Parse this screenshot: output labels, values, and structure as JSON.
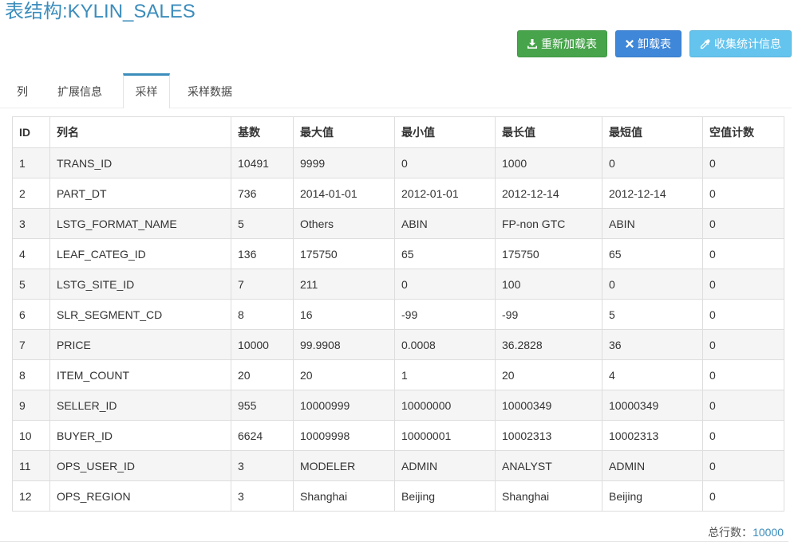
{
  "page": {
    "title": "表结构:KYLIN_SALES"
  },
  "toolbar": {
    "reload": {
      "label": "重新加载表",
      "icon": "download-icon"
    },
    "unload": {
      "label": "卸载表",
      "icon": "close-icon"
    },
    "collect_stats": {
      "label": "收集统计信息",
      "icon": "eyedropper-icon"
    }
  },
  "tabs": [
    {
      "label": "列",
      "active": false
    },
    {
      "label": "扩展信息",
      "active": false
    },
    {
      "label": "采样",
      "active": true
    },
    {
      "label": "采样数据",
      "active": false
    }
  ],
  "sample_table": {
    "headers": [
      "ID",
      "列名",
      "基数",
      "最大值",
      "最小值",
      "最长值",
      "最短值",
      "空值计数"
    ],
    "rows": [
      [
        "1",
        "TRANS_ID",
        "10491",
        "9999",
        "0",
        "1000",
        "0",
        "0"
      ],
      [
        "2",
        "PART_DT",
        "736",
        "2014-01-01",
        "2012-01-01",
        "2012-12-14",
        "2012-12-14",
        "0"
      ],
      [
        "3",
        "LSTG_FORMAT_NAME",
        "5",
        "Others",
        "ABIN",
        "FP-non GTC",
        "ABIN",
        "0"
      ],
      [
        "4",
        "LEAF_CATEG_ID",
        "136",
        "175750",
        "65",
        "175750",
        "65",
        "0"
      ],
      [
        "5",
        "LSTG_SITE_ID",
        "7",
        "211",
        "0",
        "100",
        "0",
        "0"
      ],
      [
        "6",
        "SLR_SEGMENT_CD",
        "8",
        "16",
        "-99",
        "-99",
        "5",
        "0"
      ],
      [
        "7",
        "PRICE",
        "10000",
        "99.9908",
        "0.0008",
        "36.2828",
        "36",
        "0"
      ],
      [
        "8",
        "ITEM_COUNT",
        "20",
        "20",
        "1",
        "20",
        "4",
        "0"
      ],
      [
        "9",
        "SELLER_ID",
        "955",
        "10000999",
        "10000000",
        "10000349",
        "10000349",
        "0"
      ],
      [
        "10",
        "BUYER_ID",
        "6624",
        "10009998",
        "10000001",
        "10002313",
        "10002313",
        "0"
      ],
      [
        "11",
        "OPS_USER_ID",
        "3",
        "MODELER",
        "ADMIN",
        "ANALYST",
        "ADMIN",
        "0"
      ],
      [
        "12",
        "OPS_REGION",
        "3",
        "Shanghai",
        "Beijing",
        "Shanghai",
        "Beijing",
        "0"
      ]
    ]
  },
  "footer": {
    "total_rows_label": "总行数：",
    "total_rows_value": "10000"
  },
  "colors": {
    "accent": "#3c8dbc",
    "success_button": "#47a44b",
    "primary_button": "#3f87d8",
    "info_button": "#64c4ee",
    "row_stripe": "#f5f5f5",
    "table_border": "#dddddd"
  }
}
